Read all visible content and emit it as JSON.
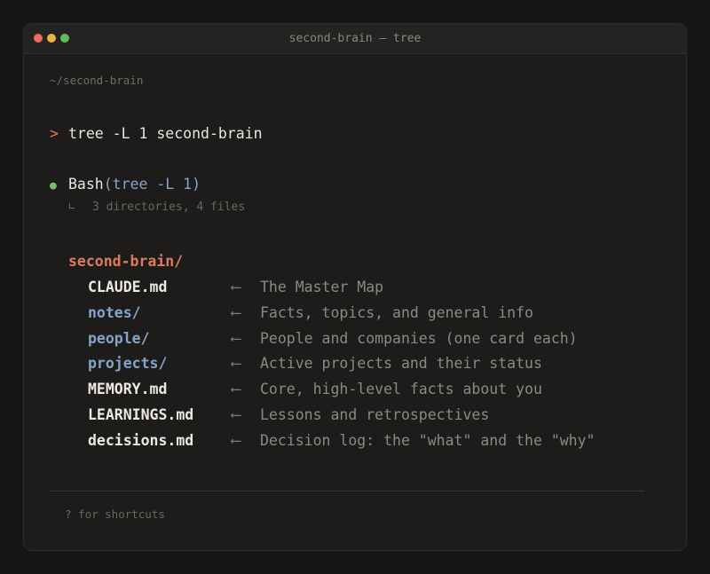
{
  "window": {
    "title": "second-brain — tree"
  },
  "terminal": {
    "cwd": "~/second-brain",
    "prompt_symbol": ">",
    "command": "tree -L 1 second-brain",
    "tool_call": {
      "bullet": "●",
      "name": "Bash",
      "args": "(tree -L 1)",
      "result_corner": "∟",
      "result": "3 directories, 4 files"
    },
    "tree": {
      "root": "second-brain/",
      "arrow": "⟵",
      "entries": [
        {
          "name": "CLAUDE.md",
          "type": "file",
          "description": "The Master Map"
        },
        {
          "name": "notes/",
          "type": "dir",
          "description": "Facts, topics, and general info"
        },
        {
          "name": "people/",
          "type": "dir",
          "description": "People and companies (one card each)"
        },
        {
          "name": "projects/",
          "type": "dir",
          "description": "Active projects and their status"
        },
        {
          "name": "MEMORY.md",
          "type": "file",
          "description": "Core, high-level facts about you"
        },
        {
          "name": "LEARNINGS.md",
          "type": "file",
          "description": "Lessons and retrospectives"
        },
        {
          "name": "decisions.md",
          "type": "file",
          "description": "Decision log: the \"what\" and the \"why\""
        }
      ]
    },
    "footer_hint": "? for shortcuts"
  },
  "colors": {
    "accent": "#e07a5f",
    "directory": "#84a4c7",
    "success_dot": "#7cbf6b",
    "background": "#1d1c1b"
  }
}
